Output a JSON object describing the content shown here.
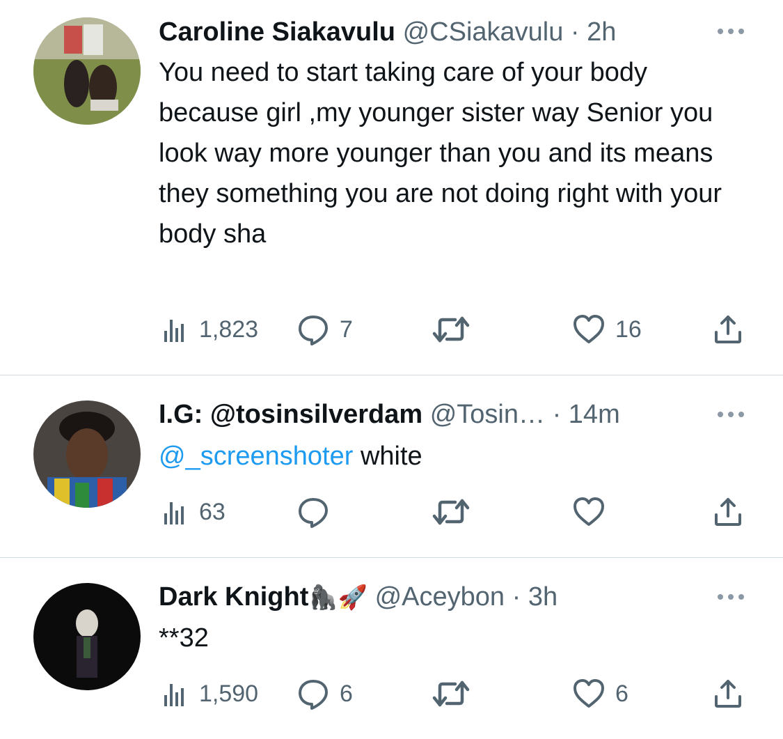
{
  "tweets": [
    {
      "name": "Caroline Siakavulu",
      "handle": "@CSiakavulu",
      "time": "2h",
      "text": "You need to start taking care of your body because girl ,my younger sister way Senior you look way more younger than you and its means they something you are not doing right with your body sha",
      "views": "1,823",
      "replies": "7",
      "retweets": "",
      "likes": "16"
    },
    {
      "name": "I.G: @tosinsilverdam",
      "handle": "@Tosin…",
      "time": "14m",
      "mention": "@_screenshoter",
      "text": " white",
      "views": "63",
      "replies": "",
      "retweets": "",
      "likes": ""
    },
    {
      "name": "Dark Knight",
      "name_emoji": "🦍🚀",
      "handle": "@Aceybon",
      "time": "3h",
      "text": "**32",
      "views": "1,590",
      "replies": "6",
      "retweets": "",
      "likes": "6"
    }
  ],
  "separator": " · ",
  "icons": [
    "views-icon",
    "reply-icon",
    "retweet-icon",
    "like-icon",
    "share-icon",
    "more-icon"
  ],
  "colors": {
    "text": "#0f1419",
    "secondary": "#536471",
    "link": "#1d9bf0",
    "divider": "#cfd9de"
  }
}
